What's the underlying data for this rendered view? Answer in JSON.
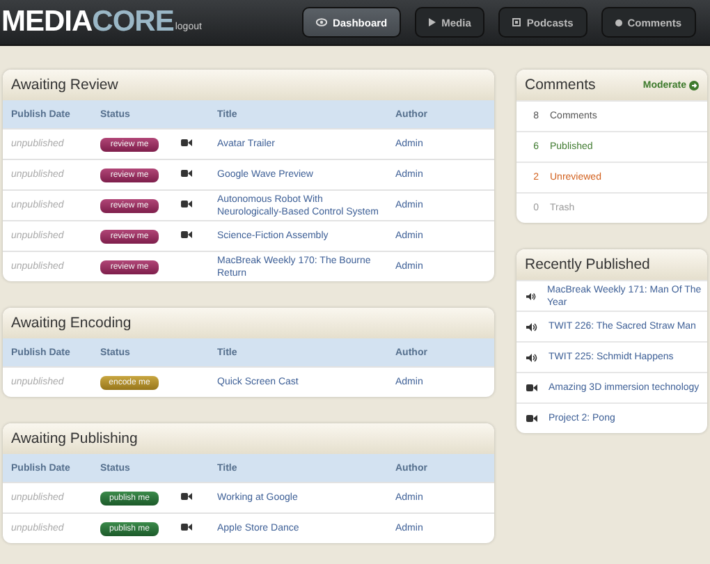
{
  "header": {
    "logo": {
      "first": "MEDIA",
      "second": "CORE"
    },
    "logout": "logout",
    "nav": [
      {
        "label": "Dashboard",
        "selected": true
      },
      {
        "label": "Media",
        "selected": false
      },
      {
        "label": "Podcasts",
        "selected": false
      },
      {
        "label": "Comments",
        "selected": false
      }
    ]
  },
  "sections": [
    {
      "title": "Awaiting Review",
      "columns": [
        "Publish Date",
        "Status",
        "Title",
        "Author"
      ],
      "rows": [
        {
          "date": "unpublished",
          "status": {
            "label": "review me",
            "kind": "review"
          },
          "kind": "video",
          "title": "Avatar Trailer",
          "author": "Admin"
        },
        {
          "date": "unpublished",
          "status": {
            "label": "review me",
            "kind": "review"
          },
          "kind": "video",
          "title": "Google Wave Preview",
          "author": "Admin"
        },
        {
          "date": "unpublished",
          "status": {
            "label": "review me",
            "kind": "review"
          },
          "kind": "video",
          "title": "Autonomous Robot With Neurologically-Based Control System",
          "author": "Admin"
        },
        {
          "date": "unpublished",
          "status": {
            "label": "review me",
            "kind": "review"
          },
          "kind": "video",
          "title": "Science-Fiction Assembly",
          "author": "Admin"
        },
        {
          "date": "unpublished",
          "status": {
            "label": "review me",
            "kind": "review"
          },
          "kind": "plain",
          "title": "MacBreak Weekly 170: The Bourne Return",
          "author": "Admin"
        }
      ]
    },
    {
      "title": "Awaiting Encoding",
      "columns": [
        "Publish Date",
        "Status",
        "Title",
        "Author"
      ],
      "rows": [
        {
          "date": "unpublished",
          "status": {
            "label": "encode me",
            "kind": "encode"
          },
          "kind": "plain",
          "title": "Quick Screen Cast",
          "author": "Admin"
        }
      ]
    },
    {
      "title": "Awaiting Publishing",
      "columns": [
        "Publish Date",
        "Status",
        "Title",
        "Author"
      ],
      "rows": [
        {
          "date": "unpublished",
          "status": {
            "label": "publish me",
            "kind": "publish"
          },
          "kind": "video",
          "title": "Working at Google",
          "author": "Admin"
        },
        {
          "date": "unpublished",
          "status": {
            "label": "publish me",
            "kind": "publish"
          },
          "kind": "video",
          "title": "Apple Store Dance",
          "author": "Admin"
        }
      ]
    }
  ],
  "comments": {
    "title": "Comments",
    "action": "Moderate",
    "items": [
      {
        "count": "8",
        "label": "Comments",
        "kind": "total"
      },
      {
        "count": "6",
        "label": "Published",
        "kind": "published"
      },
      {
        "count": "2",
        "label": "Unreviewed",
        "kind": "unreviewed"
      },
      {
        "count": "0",
        "label": "Trash",
        "kind": "trash"
      }
    ]
  },
  "recent": {
    "title": "Recently Published",
    "items": [
      {
        "kind": "audio",
        "title": "MacBreak Weekly 171: Man Of The Year"
      },
      {
        "kind": "audio",
        "title": "TWIT 226: The Sacred Straw Man"
      },
      {
        "kind": "audio",
        "title": "TWIT 225: Schmidt Happens"
      },
      {
        "kind": "video",
        "title": "Amazing 3D immersion technology"
      },
      {
        "kind": "video",
        "title": "Project 2: Pong"
      }
    ]
  }
}
